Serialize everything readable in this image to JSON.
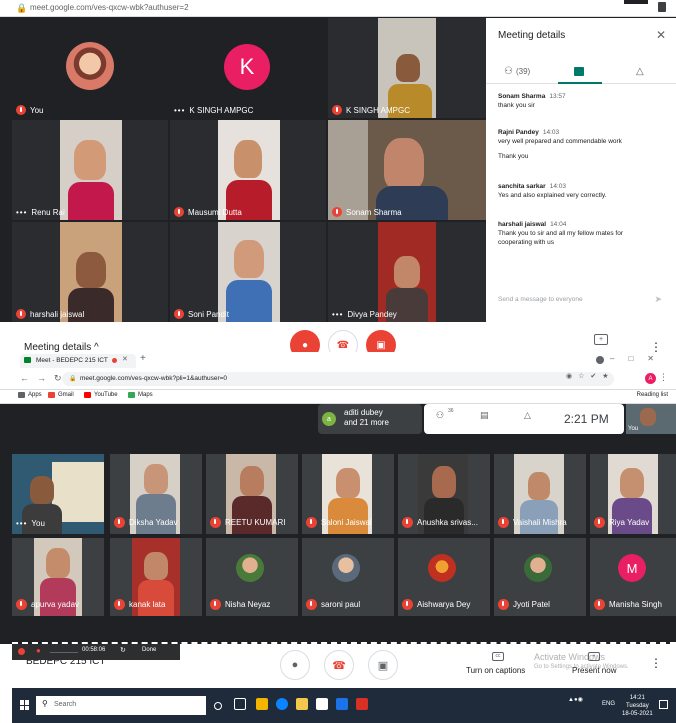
{
  "top_window": {
    "url": "meet.google.com/ves-qxcw-wbk?authuser=2",
    "tiles": [
      {
        "name": "You",
        "kind": "avatar-photo",
        "muted": true
      },
      {
        "name": "K SINGH AMPGC",
        "kind": "letter",
        "letter": "K",
        "muted": false
      },
      {
        "name": "K SINGH AMPGC",
        "kind": "video",
        "muted": true
      },
      {
        "name": "Renu Rai",
        "kind": "video",
        "muted": false
      },
      {
        "name": "Mausumi Dutta",
        "kind": "video",
        "muted": true
      },
      {
        "name": "Sonam Sharma",
        "kind": "video",
        "muted": true
      },
      {
        "name": "harshali jaiswal",
        "kind": "video",
        "muted": true
      },
      {
        "name": "Soni Pandit",
        "kind": "video",
        "muted": true
      },
      {
        "name": "Divya Pandey",
        "kind": "video",
        "muted": false
      }
    ],
    "side_panel": {
      "title": "Meeting details",
      "close_icon": "close-icon",
      "people_count": "(39)",
      "messages": [
        {
          "sender": "Sonam Sharma",
          "time": "13:57",
          "lines": [
            "thank you sir"
          ]
        },
        {
          "sender": "Rajni Pandey",
          "time": "14:03",
          "lines": [
            "very well prepared and commendable work",
            "Thank you"
          ]
        },
        {
          "sender": "sanchita sarkar",
          "time": "14:03",
          "lines": [
            "Yes  and also explained very correctly."
          ]
        },
        {
          "sender": "harshali jaiswal",
          "time": "14:04",
          "lines": [
            "Thank you to sir and all my fellow mates for",
            "cooperating with us"
          ]
        }
      ],
      "send_placeholder": "Send a message to everyone"
    },
    "bottom_bar": {
      "meeting_details": "Meeting details",
      "chevron": "^"
    }
  },
  "bottom_window": {
    "tab_title": "Meet - BEDEPC 215 ICT",
    "url": "meet.google.com/ves-qxcw-wbk?pli=1&authuser=0",
    "bookmarks": [
      "Apps",
      "Gmail",
      "YouTube",
      "Maps"
    ],
    "reading_list": "Reading list",
    "profile_letter": "A",
    "participant_chip": {
      "letter": "a",
      "line1": "aditi dubey",
      "line2": "and 21 more"
    },
    "people_badge": "36",
    "clock": "2:21 PM",
    "self_thumb": "You",
    "row1": [
      {
        "name": "You",
        "muted": false
      },
      {
        "name": "Diksha Yadav",
        "muted": true
      },
      {
        "name": "REETU KUMARI",
        "muted": true
      },
      {
        "name": "Saloni Jaiswal",
        "muted": true
      },
      {
        "name": "Anushka srivas...",
        "muted": true
      },
      {
        "name": "Vaishali Mishra",
        "muted": true
      },
      {
        "name": "Riya Yadav",
        "muted": true
      }
    ],
    "row2": [
      {
        "name": "apurva yadav",
        "muted": true
      },
      {
        "name": "kanak lata",
        "muted": true
      },
      {
        "name": "Nisha Neyaz",
        "muted": true
      },
      {
        "name": "saroni paul",
        "muted": true
      },
      {
        "name": "Aishwarya Dey",
        "muted": true
      },
      {
        "name": "Jyoti Patel",
        "muted": true
      },
      {
        "name": "Manisha Singh",
        "muted": true,
        "letter": "M"
      }
    ],
    "recording": {
      "time": "00:58:06",
      "done": "Done"
    },
    "meeting_name": "BEDEPC 215 ICT",
    "chevron": "^",
    "captions": "Turn on captions",
    "present": "Present now",
    "activate_line1": "Activate Windows",
    "activate_line2": "Go to Settings to activate Windows."
  },
  "taskbar": {
    "search": "Search",
    "lang": "ENG",
    "time": "14:21",
    "day": "Tuesday",
    "date": "18-05-2021"
  }
}
